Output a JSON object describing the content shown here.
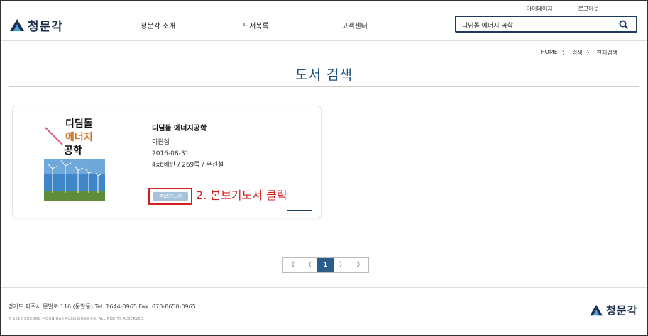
{
  "top_links": {
    "mypage": "마이페이지",
    "logout": "로그아웃"
  },
  "logo": {
    "text": "청문각"
  },
  "nav": {
    "about": "청문각 소개",
    "books": "도서목록",
    "support": "고객센터"
  },
  "search": {
    "value": "디딤돌 에너지 공학"
  },
  "breadcrumb": {
    "home": "HOME",
    "sep1": "〉",
    "search": "검색",
    "sep2": "〉",
    "all": "전체검색"
  },
  "page_title": "도서 검색",
  "book": {
    "cover_title_line1": "디딤돌",
    "cover_title_line2": "에너지",
    "cover_title_line3": "공학",
    "title": "디딤돌 에너지공학",
    "author": "이원섭",
    "date": "2016-08-31",
    "spec": "4x6배판 / 269쪽 / 무선철",
    "preview_label": "본보기도서"
  },
  "annotation": "2. 본보기도서 클릭",
  "pagination": {
    "first": "《",
    "prev": "〈",
    "current": "1",
    "next": "〉",
    "last": "》"
  },
  "footer": {
    "address": "경기도 파주시 문발로 116 (문발동) Tel. 1644-0965 Fax. 070-8650-0965",
    "copyright": "© 2018 CHEONG MOON GAK PUBLISHING CO. ALL RIGHTS RESERVED.",
    "logo_text": "청문각"
  },
  "colors": {
    "brand": "#1d2f4f",
    "accent": "#1e4e7a",
    "annotation": "#d02020",
    "preview_button": "#a6c3d9"
  }
}
